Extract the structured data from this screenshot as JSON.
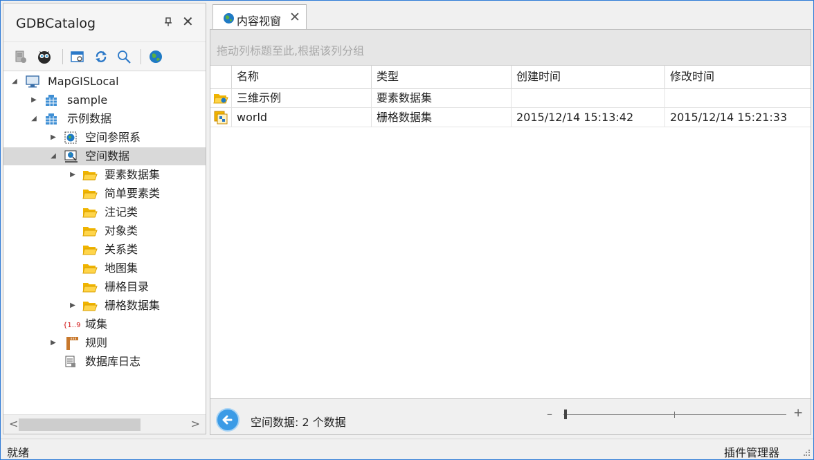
{
  "left_panel": {
    "title": "GDBCatalog",
    "pin_glyph": "░",
    "close_glyph": "✕",
    "toolbar_icons": [
      "server-icon",
      "owl-icon",
      "window-settings-icon",
      "refresh-icon",
      "search-icon",
      "globe-icon"
    ]
  },
  "tree": {
    "root": "MapGISLocal",
    "sample": "sample",
    "demo": "示例数据",
    "spatial_ref": "空间参照系",
    "spatial_data": "空间数据",
    "feature_dataset": "要素数据集",
    "simple_feature": "简单要素类",
    "annotation": "注记类",
    "object_class": "对象类",
    "relation_class": "关系类",
    "map_set": "地图集",
    "raster_catalog": "栅格目录",
    "raster_dataset": "栅格数据集",
    "domain_set": "域集",
    "rules": "规则",
    "db_log": "数据库日志"
  },
  "tab": {
    "label": "内容视窗",
    "close_glyph": "✕"
  },
  "group_panel_text": "拖动列标题至此,根据该列分组",
  "grid": {
    "columns": [
      "名称",
      "类型",
      "创建时间",
      "修改时间"
    ],
    "rows": [
      {
        "name": "三维示例",
        "type": "要素数据集",
        "created": "",
        "modified": ""
      },
      {
        "name": "world",
        "type": "栅格数据集",
        "created": "2015/12/14 15:13:42",
        "modified": "2015/12/14 15:21:33"
      }
    ]
  },
  "footer": {
    "status": "空间数据: 2 个数据",
    "zoom_minus": "–",
    "zoom_plus": "+"
  },
  "statusbar": {
    "left": "就绪",
    "right": "插件管理器"
  },
  "colors": {
    "accent": "#2b79d6",
    "folder": "#f0b400",
    "selected_row": "#d9d9d9"
  }
}
